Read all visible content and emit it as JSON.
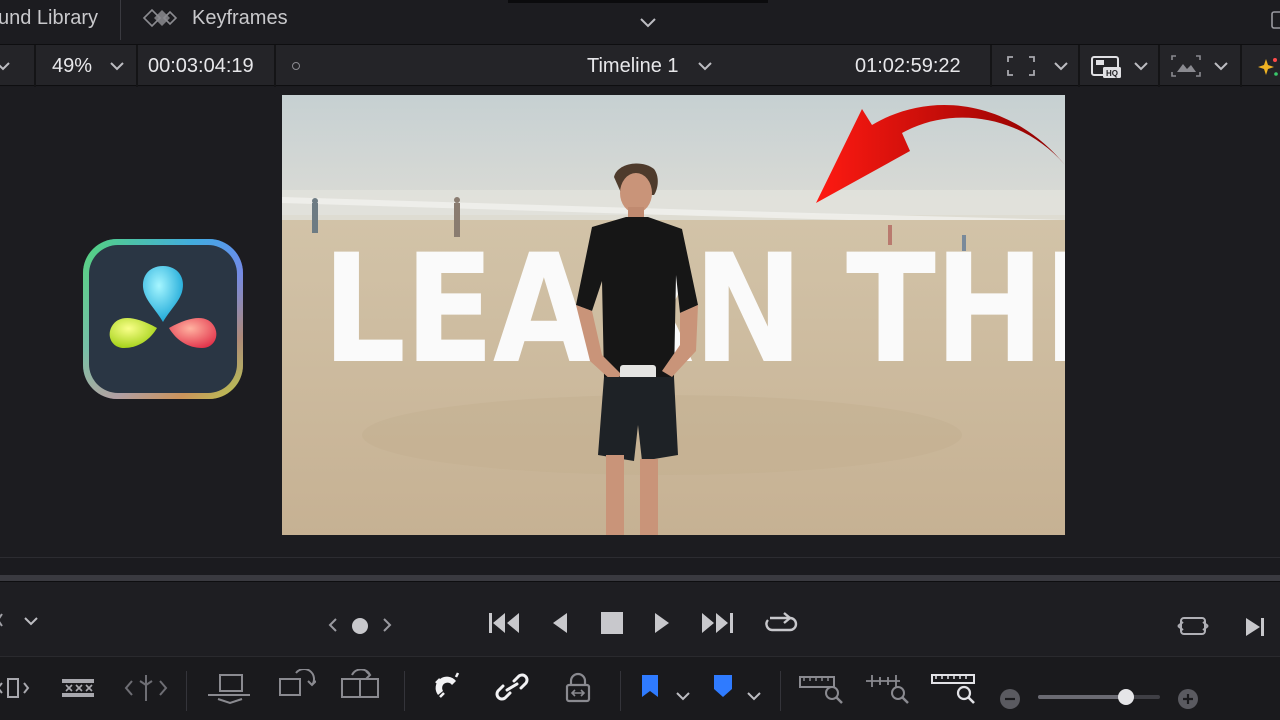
{
  "tabs": {
    "sound_library": "und Library",
    "keyframes": "Keyframes"
  },
  "viewer_header": {
    "zoom": "49%",
    "source_timecode": "00:03:04:19",
    "timeline_name": "Timeline 1",
    "record_timecode": "01:02:59:22"
  },
  "video": {
    "overlay_text": "LEARN THIS"
  },
  "zoom_slider": {
    "value_fraction": 0.72
  },
  "colors": {
    "accent_blue": "#2f7bff",
    "arrow_red": "#d10f0f"
  }
}
